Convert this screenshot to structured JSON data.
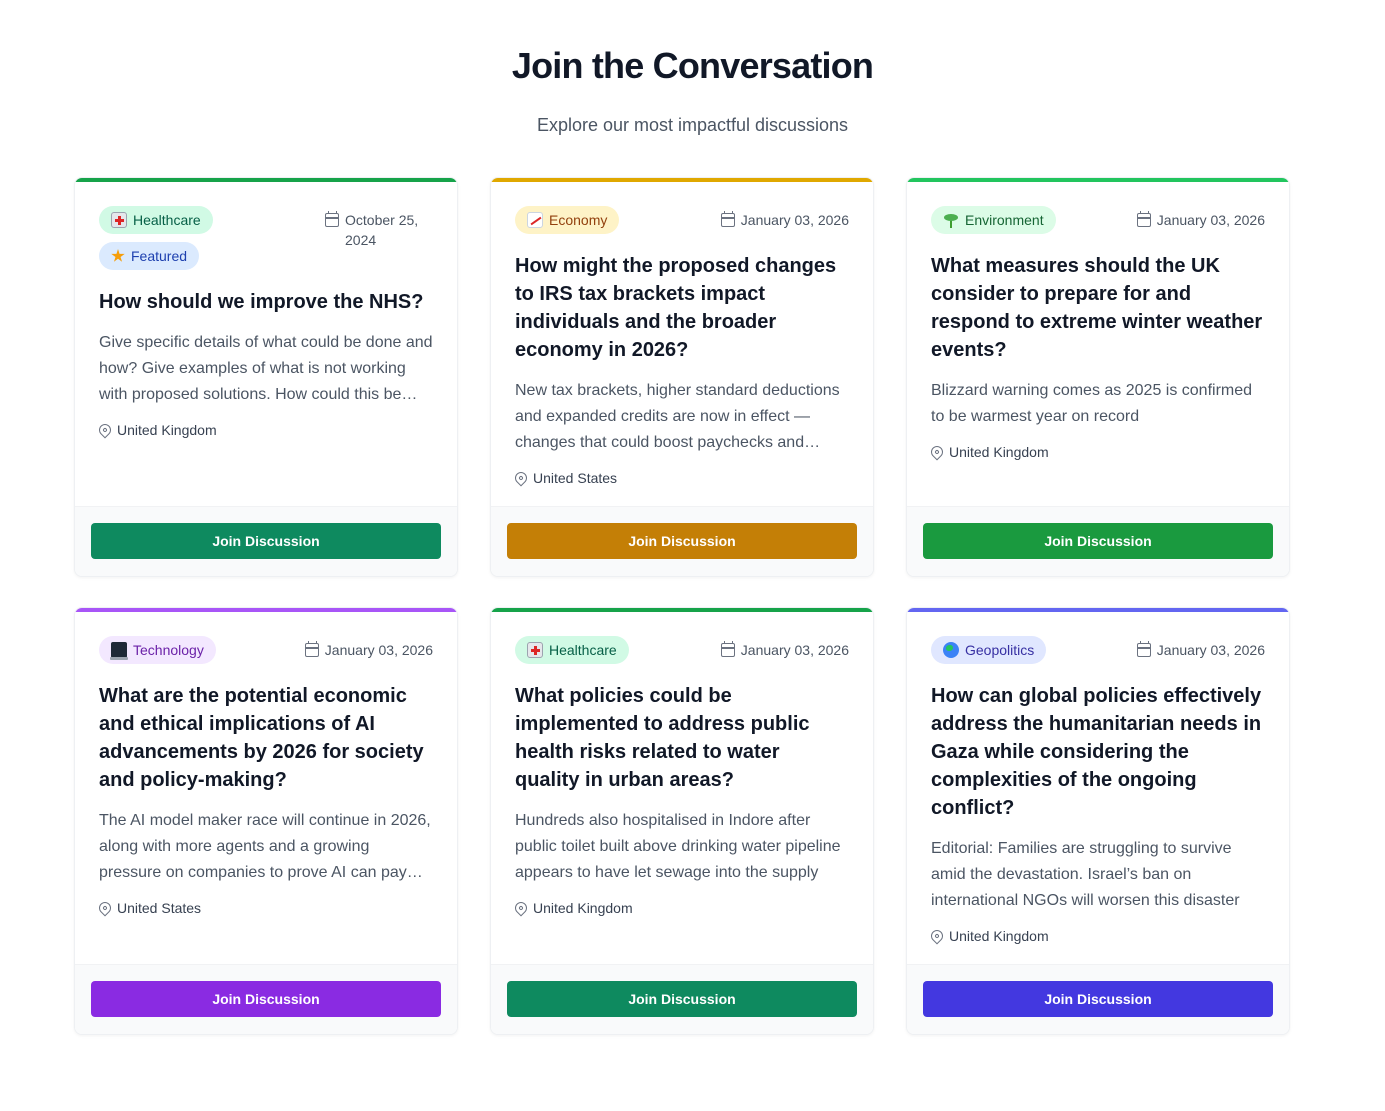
{
  "header": {
    "title": "Join the Conversation",
    "subtitle": "Explore our most impactful discussions"
  },
  "cards": [
    {
      "accent": "#16a34a",
      "tags": [
        {
          "label": "Healthcare",
          "icon": "hospital-emoji-icon",
          "bg": "#d1fae5",
          "fg": "#065f46"
        },
        {
          "label": "Featured",
          "icon": "star-icon",
          "bg": "#dbeafe",
          "fg": "#1e40af"
        }
      ],
      "date": "October 25, 2024",
      "title": "How should we improve the NHS?",
      "description": "Give specific details of what could be done and how? Give examples of what is not working with proposed solutions. How could this be funded?",
      "location": "United Kingdom",
      "button": "Join Discussion",
      "button_color": "#0e8a5f"
    },
    {
      "accent": "#e0a800",
      "tags": [
        {
          "label": "Economy",
          "icon": "chart-increasing-emoji-icon",
          "bg": "#fef3c7",
          "fg": "#92400e"
        }
      ],
      "date": "January 03, 2026",
      "title": "How might the proposed changes to IRS tax brackets impact individuals and the broader economy in 2026?",
      "description": "New tax brackets, higher standard deductions and expanded credits are now in effect — changes that could boost paychecks and refunds.",
      "location": "United States",
      "button": "Join Discussion",
      "button_color": "#c47f06"
    },
    {
      "accent": "#22c55e",
      "tags": [
        {
          "label": "Environment",
          "icon": "seedling-emoji-icon",
          "bg": "#dcfce7",
          "fg": "#166534"
        }
      ],
      "date": "January 03, 2026",
      "title": "What measures should the UK consider to prepare for and respond to extreme winter weather events?",
      "description": "Blizzard warning comes as 2025 is confirmed to be warmest year on record",
      "location": "United Kingdom",
      "button": "Join Discussion",
      "button_color": "#1a9a3f"
    },
    {
      "accent": "#a855f7",
      "tags": [
        {
          "label": "Technology",
          "icon": "laptop-emoji-icon",
          "bg": "#f3e8ff",
          "fg": "#6b21a8"
        }
      ],
      "date": "January 03, 2026",
      "title": "What are the potential economic and ethical implications of AI advancements by 2026 for society and policy-making?",
      "description": "The AI model maker race will continue in 2026, along with more agents and a growing pressure on companies to prove AI can pay off.",
      "location": "United States",
      "button": "Join Discussion",
      "button_color": "#8a2be2"
    },
    {
      "accent": "#16a34a",
      "tags": [
        {
          "label": "Healthcare",
          "icon": "hospital-emoji-icon",
          "bg": "#d1fae5",
          "fg": "#065f46"
        }
      ],
      "date": "January 03, 2026",
      "title": "What policies could be implemented to address public health risks related to water quality in urban areas?",
      "description": "Hundreds also hospitalised in Indore after public toilet built above drinking water pipeline appears to have let sewage into the supply",
      "location": "United Kingdom",
      "button": "Join Discussion",
      "button_color": "#0e8a5f"
    },
    {
      "accent": "#6366f1",
      "tags": [
        {
          "label": "Geopolitics",
          "icon": "globe-emoji-icon",
          "bg": "#e0e7ff",
          "fg": "#3730a3"
        }
      ],
      "date": "January 03, 2026",
      "title": "How can global policies effectively address the humanitarian needs in Gaza while considering the complexities of the ongoing conflict?",
      "description": "Editorial: Families are struggling to survive amid the devastation. Israel’s ban on international NGOs will worsen this disaster",
      "location": "United Kingdom",
      "button": "Join Discussion",
      "button_color": "#4338e0"
    }
  ]
}
